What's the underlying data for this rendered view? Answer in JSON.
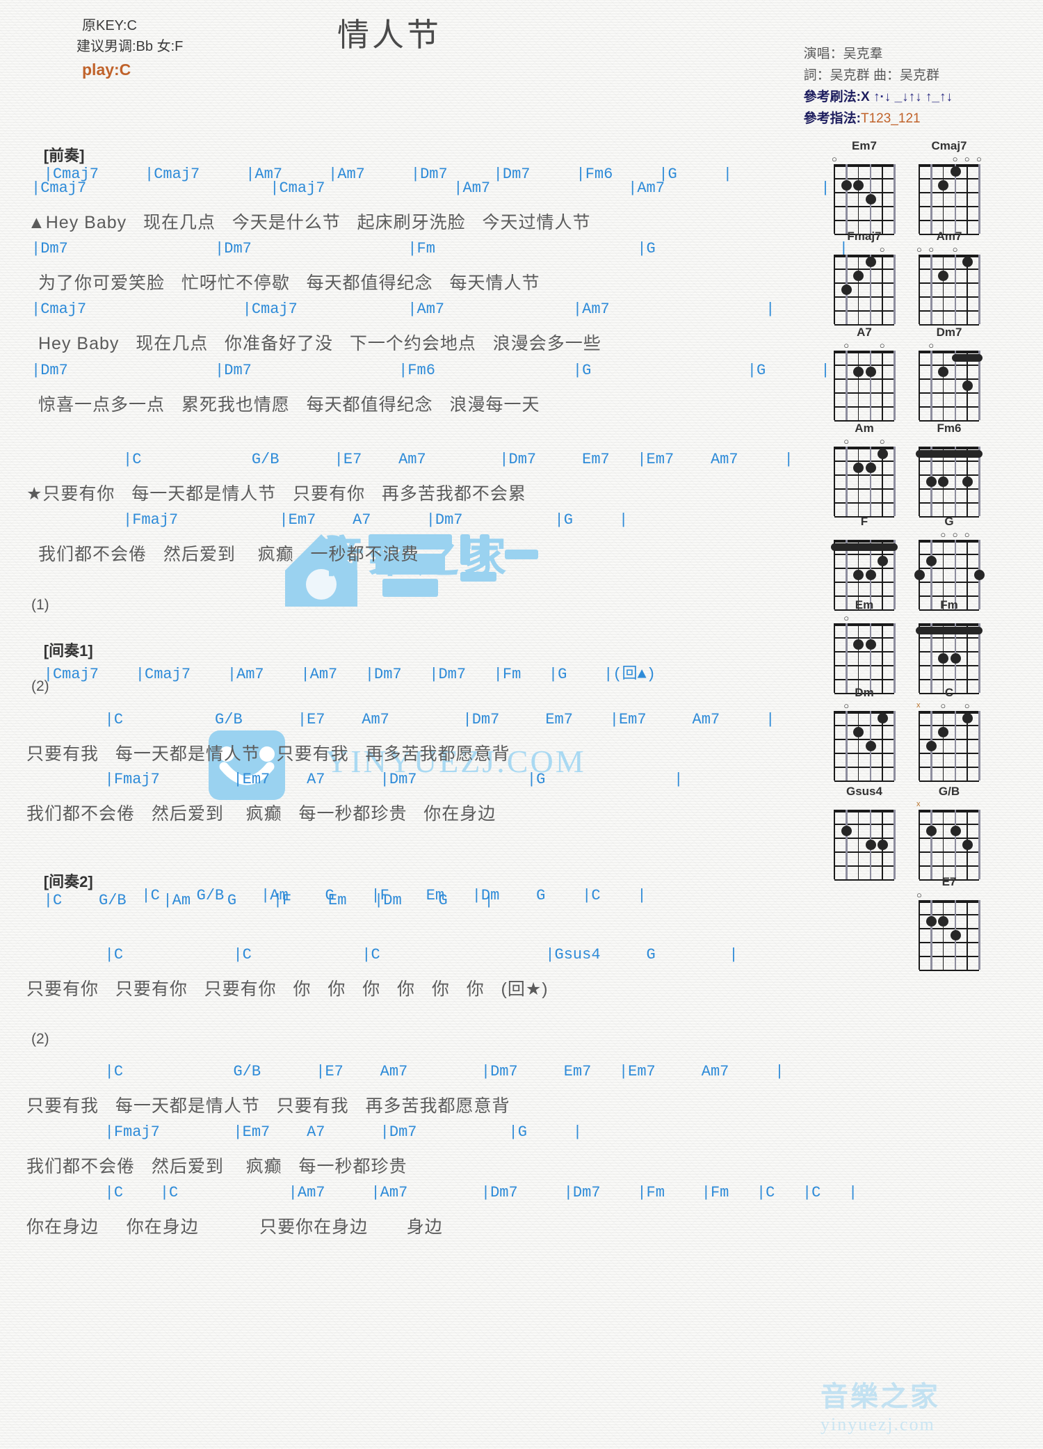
{
  "header": {
    "title": "情人节",
    "orig_key": "原KEY:C",
    "suggest_key": "建议男调:Bb 女:F",
    "play_key": "play:C",
    "singer": "演唱：吴克羣",
    "writer": "詞：吴克群  曲：吴克群",
    "strum_label": "參考刷法:X",
    "strum_pattern": "↑·↓ _↓↑↓ ↑_↑↓",
    "finger_label": "參考指法:",
    "finger_pattern": "T123_121"
  },
  "watermark": {
    "cn": "音樂之家",
    "url": "YINYUEZJ.COM",
    "bottom_cn": "音樂之家",
    "bottom_url": "yinyuezj.com"
  },
  "sections": [
    {
      "tag": "[前奏]",
      "chords": "|Cmaj7     |Cmaj7     |Am7     |Am7     |Dm7     |Dm7     |Fm6     |G     |"
    }
  ],
  "body_lines": [
    {
      "id": "l1",
      "type": "chords",
      "text": "|Cmaj7                    |Cmaj7              |Am7               |Am7                 |"
    },
    {
      "id": "l2",
      "type": "lyric",
      "text": "▲Hey Baby   现在几点   今天是什么节   起床刷牙洗脸   今天过情人节"
    },
    {
      "id": "l3",
      "type": "chords",
      "text": "|Dm7                |Dm7                 |Fm                      |G                    |"
    },
    {
      "id": "l4",
      "type": "lyric",
      "text": "为了你可爱笑脸   忙呀忙不停歇   每天都值得纪念   每天情人节"
    },
    {
      "id": "l5",
      "type": "chords",
      "text": "|Cmaj7                 |Cmaj7            |Am7              |Am7                 |"
    },
    {
      "id": "l6",
      "type": "lyric",
      "text": "Hey Baby   现在几点   你准备好了没   下一个约会地点   浪漫会多一些"
    },
    {
      "id": "l7",
      "type": "chords",
      "text": "|Dm7                |Dm7                |Fm6               |G                 |G      |"
    },
    {
      "id": "l8",
      "type": "lyric",
      "text": "惊喜一点多一点   累死我也情愿   每天都值得纪念   浪漫每一天"
    },
    {
      "id": "l9",
      "type": "chords",
      "text": "          |C            G/B      |E7    Am7        |Dm7     Em7   |Em7    Am7     |"
    },
    {
      "id": "l10",
      "type": "lyric",
      "text": "★只要有你   每一天都是情人节   只要有你   再多苦我都不会累"
    },
    {
      "id": "l11",
      "type": "chords",
      "text": "          |Fmaj7           |Em7    A7      |Dm7          |G     |"
    },
    {
      "id": "l12",
      "type": "lyric",
      "text": "我们都不会倦   然后爱到    疯癫   一秒都不浪费"
    },
    {
      "id": "l13",
      "type": "num",
      "text": "(1)"
    },
    {
      "id": "l14",
      "type": "chords-tag",
      "tag": "[间奏1]",
      "text": "|Cmaj7    |Cmaj7    |Am7    |Am7   |Dm7   |Dm7   |Fm   |G    |(回▲)"
    },
    {
      "id": "l15",
      "type": "num",
      "text": "(2)"
    },
    {
      "id": "l16",
      "type": "chords",
      "text": "        |C          G/B      |E7    Am7        |Dm7     Em7    |Em7     Am7     |"
    },
    {
      "id": "l17",
      "type": "lyric",
      "text": "只要有我   每一天都是情人节   只要有我   再多苦我都愿意背"
    },
    {
      "id": "l18",
      "type": "chords",
      "text": "        |Fmaj7        |Em7    A7      |Dm7            |G              |"
    },
    {
      "id": "l19",
      "type": "lyric",
      "text": "我们都不会倦   然后爱到    疯癫   每一秒都珍贵   你在身边"
    },
    {
      "id": "l20",
      "type": "chords-tag",
      "tag": "[间奏2]",
      "text": "|C    G/B    |Am    G    |F    Em   |Dm    G    |"
    },
    {
      "id": "l21",
      "type": "chords",
      "text": "            |C    G/B    |Am    G    |F    Em   |Dm    G    |C    |"
    },
    {
      "id": "l22",
      "type": "chords",
      "text": "        |C            |C            |C                  |Gsus4     G        |"
    },
    {
      "id": "l23",
      "type": "lyric",
      "text": "只要有你   只要有你   只要有你   你   你   你   你   你   你   (回★)"
    },
    {
      "id": "l24",
      "type": "num",
      "text": "(2)"
    },
    {
      "id": "l25",
      "type": "chords",
      "text": "        |C            G/B      |E7    Am7        |Dm7     Em7   |Em7     Am7     |"
    },
    {
      "id": "l26",
      "type": "lyric",
      "text": "只要有我   每一天都是情人节   只要有我   再多苦我都愿意背"
    },
    {
      "id": "l27",
      "type": "chords",
      "text": "        |Fmaj7        |Em7    A7      |Dm7          |G     |"
    },
    {
      "id": "l28",
      "type": "lyric",
      "text": "我们都不会倦   然后爱到    疯癫   每一秒都珍贵"
    },
    {
      "id": "l29",
      "type": "chords",
      "text": "        |C    |C            |Am7     |Am7        |Dm7     |Dm7    |Fm    |Fm   |C   |C   |"
    },
    {
      "id": "l30",
      "type": "lyric",
      "text": "你在身边     你在身边           只要你在身边       身边"
    }
  ],
  "diagrams": [
    {
      "name": "Em7",
      "open": "x...o",
      "markers": "o at 6th",
      "row": 0,
      "col": 0
    },
    {
      "name": "Cmaj7",
      "open": "ooo",
      "row": 0,
      "col": 1
    },
    {
      "name": "Fmaj7",
      "open": "o",
      "row": 1,
      "col": 0
    },
    {
      "name": "Am7",
      "open": "o o o",
      "row": 1,
      "col": 1
    },
    {
      "name": "A7",
      "open": "o o",
      "row": 2,
      "col": 0
    },
    {
      "name": "Dm7",
      "open": "x o",
      "row": 2,
      "col": 1
    },
    {
      "name": "Am",
      "open": "o   o",
      "row": 3,
      "col": 0
    },
    {
      "name": "Fm6",
      "open": "",
      "row": 3,
      "col": 1
    },
    {
      "name": "F",
      "open": "",
      "row": 4,
      "col": 0
    },
    {
      "name": "G",
      "open": "",
      "row": 4,
      "col": 1
    },
    {
      "name": "Em",
      "open": "o",
      "row": 5,
      "col": 0
    },
    {
      "name": "Fm",
      "open": "",
      "row": 5,
      "col": 1
    },
    {
      "name": "Dm",
      "open": "o",
      "row": 6,
      "col": 0
    },
    {
      "name": "C",
      "open": "x o",
      "row": 6,
      "col": 1
    },
    {
      "name": "Gsus4",
      "open": "",
      "row": 7,
      "col": 0
    },
    {
      "name": "G/B",
      "open": "x",
      "row": 7,
      "col": 1
    },
    {
      "name": "E7",
      "open": "o",
      "row": 8,
      "col": 1
    }
  ]
}
